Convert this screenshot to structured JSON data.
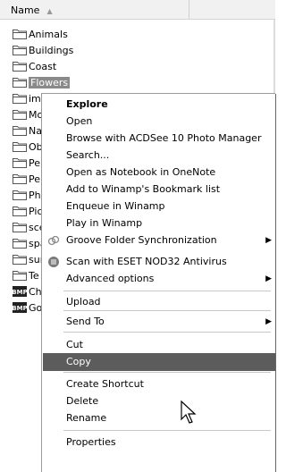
{
  "header": {
    "name_label": "Name",
    "sort_indicator": "▲"
  },
  "files": [
    {
      "label": "Animals",
      "icon": "folder-icon"
    },
    {
      "label": "Buildings",
      "icon": "folder-icon"
    },
    {
      "label": "Coast",
      "icon": "folder-icon"
    },
    {
      "label": "Flowers",
      "icon": "folder-icon",
      "selected": true
    },
    {
      "label": "ima",
      "icon": "folder-icon"
    },
    {
      "label": "Mo",
      "icon": "folder-icon"
    },
    {
      "label": "Na",
      "icon": "folder-icon"
    },
    {
      "label": "Ob",
      "icon": "folder-icon"
    },
    {
      "label": "Pe",
      "icon": "folder-icon"
    },
    {
      "label": "Pe",
      "icon": "folder-icon"
    },
    {
      "label": "Ph",
      "icon": "folder-icon"
    },
    {
      "label": "Pic",
      "icon": "folder-icon"
    },
    {
      "label": "sce",
      "icon": "folder-icon"
    },
    {
      "label": "spa",
      "icon": "folder-icon"
    },
    {
      "label": "sur",
      "icon": "folder-icon"
    },
    {
      "label": "Te",
      "icon": "folder-icon"
    },
    {
      "label": "Ch",
      "icon": "bmp-icon"
    },
    {
      "label": "Go",
      "icon": "bmp-icon"
    }
  ],
  "menu": {
    "items": [
      {
        "label": "Explore",
        "bold": true
      },
      {
        "label": "Open"
      },
      {
        "label": "Browse with ACDSee 10 Photo Manager"
      },
      {
        "label": "Search..."
      },
      {
        "label": "Open as Notebook in OneNote"
      },
      {
        "label": "Add to Winamp's Bookmark list"
      },
      {
        "label": "Enqueue in Winamp"
      },
      {
        "label": "Play in Winamp"
      },
      {
        "label": "Groove Folder Synchronization",
        "icon": "groove-icon",
        "submenu": true
      },
      {
        "label": "Scan with ESET NOD32 Antivirus",
        "icon": "eset-icon"
      },
      {
        "label": "Advanced options",
        "submenu": true
      },
      {
        "label": "Upload"
      },
      {
        "label": "Send To",
        "submenu": true
      },
      {
        "label": "Cut"
      },
      {
        "label": "Copy",
        "highlighted": true
      },
      {
        "label": "Create Shortcut"
      },
      {
        "label": "Delete"
      },
      {
        "label": "Rename"
      },
      {
        "label": "Properties"
      }
    ],
    "submenu_arrow": "▶"
  },
  "colors": {
    "highlight": "#5c5c5c",
    "selection": "#8a8a8a"
  }
}
